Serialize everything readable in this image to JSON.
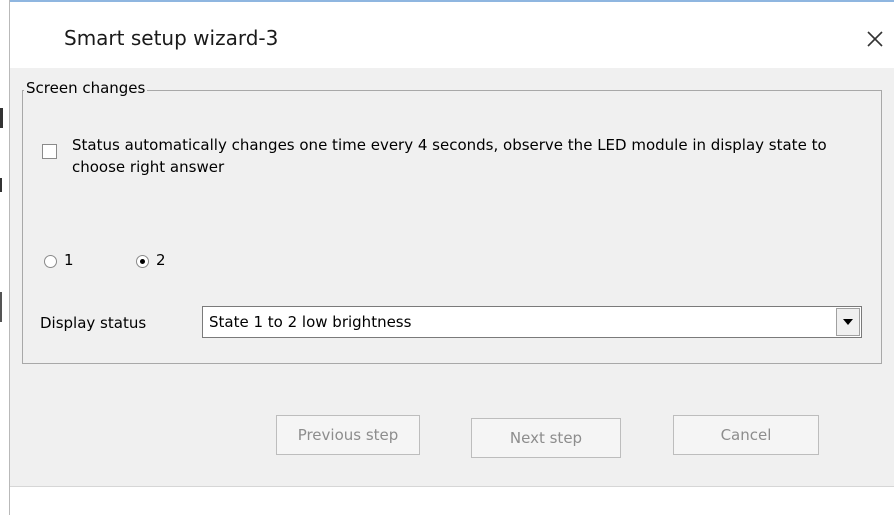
{
  "window": {
    "title": "Smart setup wizard-3",
    "close_icon": "close-icon",
    "accent_color": "#8fb6e0",
    "client_background": "#f0f0f0"
  },
  "group": {
    "label": "Screen changes",
    "checkbox": {
      "label": "Status automatically changes one time every 4 seconds, observe the LED module in display state to choose right answer",
      "checked": false
    },
    "radio_options": [
      {
        "label": "1",
        "selected": false
      },
      {
        "label": "2",
        "selected": true
      }
    ],
    "display_status": {
      "label": "Display status",
      "selected_value": "State 1 to 2 low brightness",
      "dropdown_icon": "chevron-down-icon"
    }
  },
  "buttons": {
    "previous_label": "Previous step",
    "next_label": "Next step",
    "cancel_label": "Cancel",
    "disabled_text_color": "#8d8d8d"
  }
}
